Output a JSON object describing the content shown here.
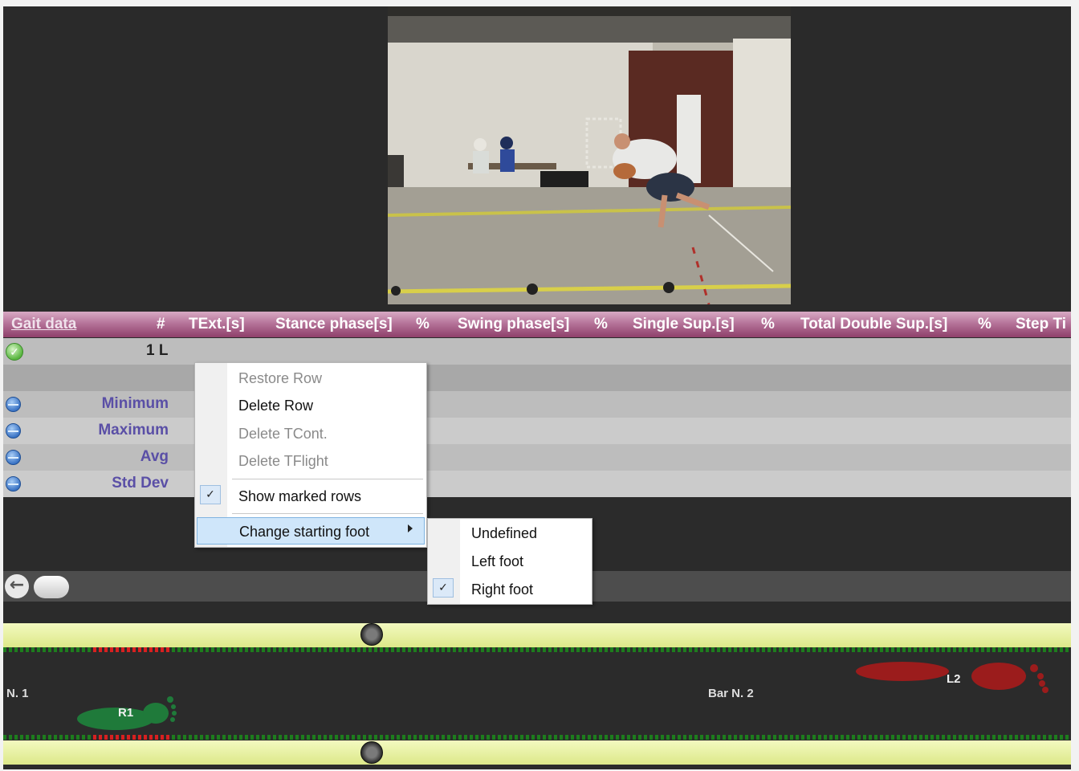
{
  "gait_table": {
    "title": "Gait data",
    "columns": [
      "#",
      "TExt.[s]",
      "Stance phase[s]",
      "%",
      "Swing phase[s]",
      "%",
      "Single Sup.[s]",
      "%",
      "Total Double Sup.[s]",
      "%",
      "Step Ti"
    ],
    "rows": [
      {
        "label": "1 L",
        "status": "green-check"
      }
    ],
    "stats": [
      "Minimum",
      "Maximum",
      "Avg",
      "Std Dev"
    ]
  },
  "context_menu": {
    "items": [
      {
        "label": "Restore Row",
        "enabled": false
      },
      {
        "label": "Delete Row",
        "enabled": true
      },
      {
        "label": "Delete TCont.",
        "enabled": false
      },
      {
        "label": "Delete TFlight",
        "enabled": false
      },
      {
        "label": "Show marked rows",
        "checked": true
      },
      {
        "label": "Change starting foot",
        "submenu": true,
        "highlighted": true
      }
    ]
  },
  "submenu": {
    "items": [
      {
        "label": "Undefined",
        "checked": false
      },
      {
        "label": "Left foot",
        "checked": false
      },
      {
        "label": "Right foot",
        "checked": true
      }
    ]
  },
  "timeline": {
    "bar_left": "N. 1",
    "bar_right": "Bar N. 2",
    "footprints": [
      {
        "label": "R1",
        "color": "#1f7a3a"
      },
      {
        "label": "L2",
        "color": "#9b1c1c"
      }
    ]
  },
  "colors": {
    "header_accent": "#8e3f6a",
    "stat_label": "#5a4fa6",
    "track": "#dde889",
    "menu_highlight": "#cfe6fa"
  },
  "icons": {
    "check": "✓",
    "back": "←"
  }
}
